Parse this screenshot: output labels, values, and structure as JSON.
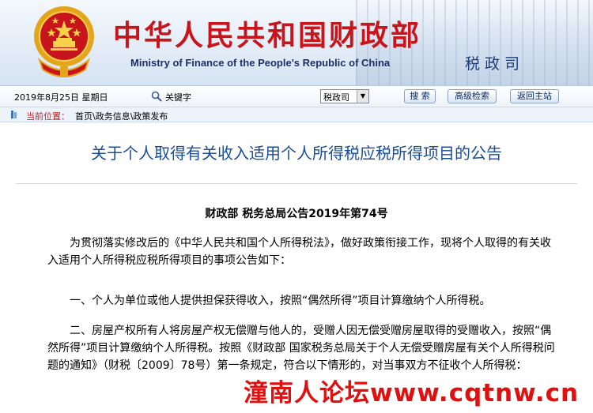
{
  "header": {
    "title_cn": "中华人民共和国财政部",
    "title_en": "Ministry of Finance of the People's Republic of China",
    "department": "税政司",
    "emblem_icon": "national-emblem-icon",
    "brand_red": "#c8141b",
    "brand_blue": "#1c2f6b"
  },
  "toolbar": {
    "date": "2019年8月25日  星期日",
    "search_icon": "search-icon",
    "keyword_label": "关键字",
    "select_value": "税政司",
    "search_button": "搜 索",
    "advanced_button": "高级检索",
    "home_button": "返回主站"
  },
  "breadcrumb": {
    "label": "当前位置：",
    "path": "首页\\政务信息\\政策发布"
  },
  "article": {
    "title": "关于个人取得有关收入适用个人所得税应税所得项目的公告",
    "doc_number": "财政部  税务总局公告2019年第74号",
    "paragraphs": [
      "为贯彻落实修改后的《中华人民共和国个人所得税法》，做好政策衔接工作，现将个人取得的有关收入适用个人所得税应税所得项目的事项公告如下：",
      "一、个人为单位或他人提供担保获得收入，按照“偶然所得”项目计算缴纳个人所得税。",
      "二、房屋产权所有人将房屋产权无偿赠与他人的，受赠人因无偿受赠房屋取得的受赠收入，按照“偶然所得”项目计算缴纳个人所得税。按照《财政部 国家税务总局关于个人无偿受赠房屋有关个人所得税问题的通知》（财税〔2009〕78号）第一条规定，符合以下情形的，对当事双方不征收个人所得税："
    ]
  },
  "watermark": "潼南人论坛www.cqtnw.cn"
}
